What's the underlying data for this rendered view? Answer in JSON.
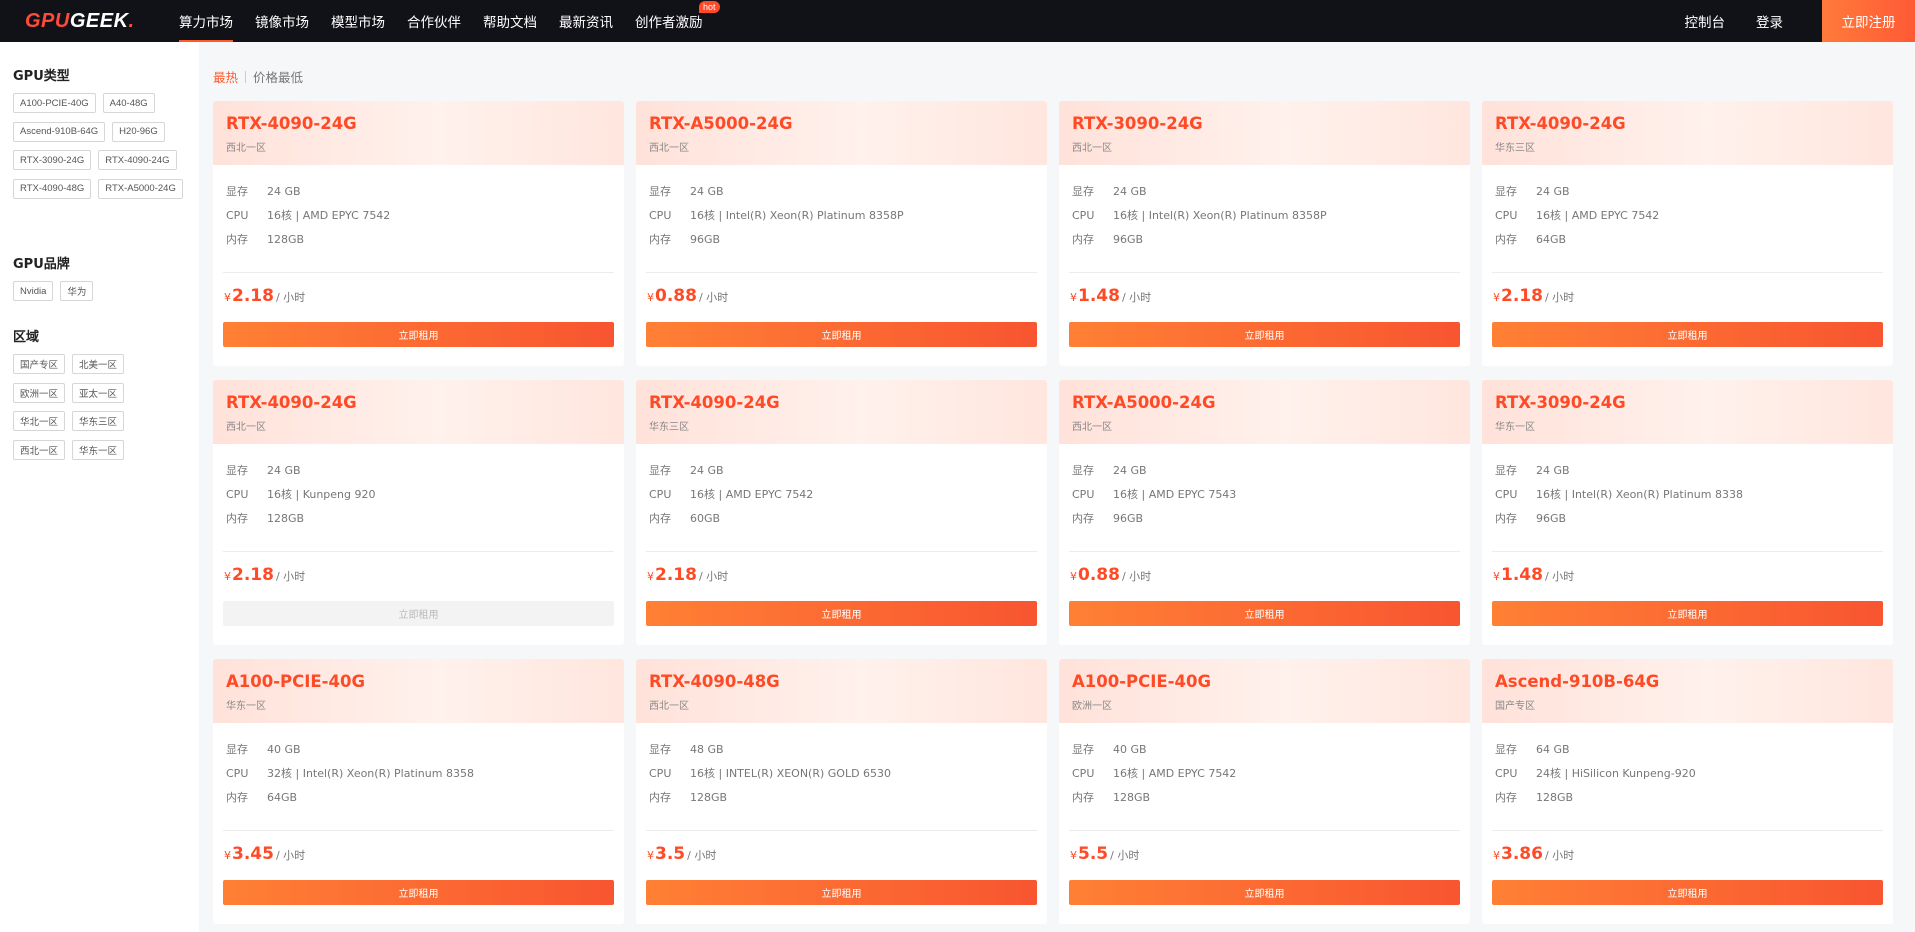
{
  "brand": {
    "logo_gpu": "GPU",
    "logo_geek": "GEEK",
    "logo_dot": "."
  },
  "nav": {
    "items": [
      {
        "label": "算力市场",
        "active": true
      },
      {
        "label": "镜像市场"
      },
      {
        "label": "模型市场"
      },
      {
        "label": "合作伙伴"
      },
      {
        "label": "帮助文档"
      },
      {
        "label": "最新资讯"
      },
      {
        "label": "创作者激励",
        "badge": "hot"
      }
    ],
    "console": "控制台",
    "login": "登录",
    "register": "立即注册"
  },
  "sidebar": {
    "gpu_type": {
      "title": "GPU类型",
      "tags": [
        "A100-PCIE-40G",
        "A40-48G",
        "Ascend-910B-64G",
        "H20-96G",
        "RTX-3090-24G",
        "RTX-4090-24G",
        "RTX-4090-48G",
        "RTX-A5000-24G"
      ]
    },
    "gpu_brand": {
      "title": "GPU品牌",
      "tags": [
        "Nvidia",
        "华为"
      ]
    },
    "region": {
      "title": "区域",
      "tags": [
        "国产专区",
        "北美一区",
        "欧洲一区",
        "亚太一区",
        "华北一区",
        "华东三区",
        "西北一区",
        "华东一区"
      ]
    }
  },
  "sort": {
    "hot": "最热",
    "price_low": "价格最低"
  },
  "labels": {
    "vram": "显存",
    "cpu": "CPU",
    "mem": "内存",
    "currency": "¥",
    "unit": "/ 小时",
    "rent": "立即租用"
  },
  "cards": [
    {
      "name": "RTX-4090-24G",
      "region": "西北一区",
      "vram": "24 GB",
      "cpu": "16核 | AMD EPYC 7542",
      "mem": "128GB",
      "price": "2.18",
      "available": true
    },
    {
      "name": "RTX-A5000-24G",
      "region": "西北一区",
      "vram": "24 GB",
      "cpu": "16核 | Intel(R) Xeon(R) Platinum 8358P",
      "mem": "96GB",
      "price": "0.88",
      "available": true
    },
    {
      "name": "RTX-3090-24G",
      "region": "西北一区",
      "vram": "24 GB",
      "cpu": "16核 | Intel(R) Xeon(R) Platinum 8358P",
      "mem": "96GB",
      "price": "1.48",
      "available": true
    },
    {
      "name": "RTX-4090-24G",
      "region": "华东三区",
      "vram": "24 GB",
      "cpu": "16核 | AMD EPYC 7542",
      "mem": "64GB",
      "price": "2.18",
      "available": true
    },
    {
      "name": "RTX-4090-24G",
      "region": "西北一区",
      "vram": "24 GB",
      "cpu": "16核 | Kunpeng 920",
      "mem": "128GB",
      "price": "2.18",
      "available": false
    },
    {
      "name": "RTX-4090-24G",
      "region": "华东三区",
      "vram": "24 GB",
      "cpu": "16核 | AMD EPYC 7542",
      "mem": "60GB",
      "price": "2.18",
      "available": true
    },
    {
      "name": "RTX-A5000-24G",
      "region": "西北一区",
      "vram": "24 GB",
      "cpu": "16核 | AMD EPYC 7543",
      "mem": "96GB",
      "price": "0.88",
      "available": true
    },
    {
      "name": "RTX-3090-24G",
      "region": "华东一区",
      "vram": "24 GB",
      "cpu": "16核 | Intel(R) Xeon(R) Platinum 8338",
      "mem": "96GB",
      "price": "1.48",
      "available": true
    },
    {
      "name": "A100-PCIE-40G",
      "region": "华东一区",
      "vram": "40 GB",
      "cpu": "32核 | Intel(R) Xeon(R) Platinum 8358",
      "mem": "64GB",
      "price": "3.45",
      "available": true
    },
    {
      "name": "RTX-4090-48G",
      "region": "西北一区",
      "vram": "48 GB",
      "cpu": "16核 | INTEL(R) XEON(R) GOLD 6530",
      "mem": "128GB",
      "price": "3.5",
      "available": true
    },
    {
      "name": "A100-PCIE-40G",
      "region": "欧洲一区",
      "vram": "40 GB",
      "cpu": "16核 | AMD EPYC 7542",
      "mem": "128GB",
      "price": "5.5",
      "available": true
    },
    {
      "name": "Ascend-910B-64G",
      "region": "国产专区",
      "vram": "64 GB",
      "cpu": "24核 | HiSilicon Kunpeng-920",
      "mem": "128GB",
      "price": "3.86",
      "available": true
    }
  ]
}
